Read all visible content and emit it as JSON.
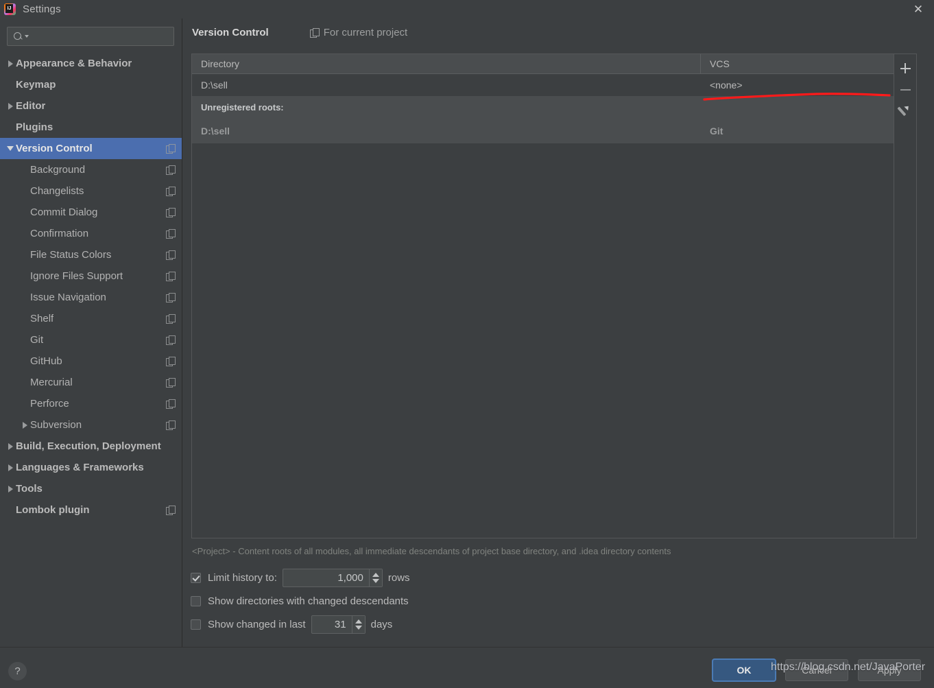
{
  "window": {
    "title": "Settings",
    "logo_icon": "intellij-idea-logo",
    "close_icon": "close-icon"
  },
  "sidebar": {
    "search": {
      "placeholder": "",
      "value": "",
      "icon": "search-icon",
      "dropdown_icon": "chevron-down-icon"
    },
    "items": [
      {
        "label": "Appearance & Behavior",
        "level": 0,
        "expandable": true,
        "expanded": false,
        "bold": true,
        "selected": false,
        "copy_icon": false
      },
      {
        "label": "Keymap",
        "level": 0,
        "expandable": false,
        "expanded": false,
        "bold": true,
        "selected": false,
        "copy_icon": false
      },
      {
        "label": "Editor",
        "level": 0,
        "expandable": true,
        "expanded": false,
        "bold": true,
        "selected": false,
        "copy_icon": false
      },
      {
        "label": "Plugins",
        "level": 0,
        "expandable": false,
        "expanded": false,
        "bold": true,
        "selected": false,
        "copy_icon": false
      },
      {
        "label": "Version Control",
        "level": 0,
        "expandable": true,
        "expanded": true,
        "bold": true,
        "selected": true,
        "copy_icon": true
      },
      {
        "label": "Background",
        "level": 1,
        "expandable": false,
        "expanded": false,
        "bold": false,
        "selected": false,
        "copy_icon": true
      },
      {
        "label": "Changelists",
        "level": 1,
        "expandable": false,
        "expanded": false,
        "bold": false,
        "selected": false,
        "copy_icon": true
      },
      {
        "label": "Commit Dialog",
        "level": 1,
        "expandable": false,
        "expanded": false,
        "bold": false,
        "selected": false,
        "copy_icon": true
      },
      {
        "label": "Confirmation",
        "level": 1,
        "expandable": false,
        "expanded": false,
        "bold": false,
        "selected": false,
        "copy_icon": true
      },
      {
        "label": "File Status Colors",
        "level": 1,
        "expandable": false,
        "expanded": false,
        "bold": false,
        "selected": false,
        "copy_icon": true
      },
      {
        "label": "Ignore Files Support",
        "level": 1,
        "expandable": false,
        "expanded": false,
        "bold": false,
        "selected": false,
        "copy_icon": true
      },
      {
        "label": "Issue Navigation",
        "level": 1,
        "expandable": false,
        "expanded": false,
        "bold": false,
        "selected": false,
        "copy_icon": true
      },
      {
        "label": "Shelf",
        "level": 1,
        "expandable": false,
        "expanded": false,
        "bold": false,
        "selected": false,
        "copy_icon": true
      },
      {
        "label": "Git",
        "level": 1,
        "expandable": false,
        "expanded": false,
        "bold": false,
        "selected": false,
        "copy_icon": true
      },
      {
        "label": "GitHub",
        "level": 1,
        "expandable": false,
        "expanded": false,
        "bold": false,
        "selected": false,
        "copy_icon": true
      },
      {
        "label": "Mercurial",
        "level": 1,
        "expandable": false,
        "expanded": false,
        "bold": false,
        "selected": false,
        "copy_icon": true
      },
      {
        "label": "Perforce",
        "level": 1,
        "expandable": false,
        "expanded": false,
        "bold": false,
        "selected": false,
        "copy_icon": true
      },
      {
        "label": "Subversion",
        "level": 1,
        "expandable": true,
        "expanded": false,
        "bold": false,
        "selected": false,
        "copy_icon": true
      },
      {
        "label": "Build, Execution, Deployment",
        "level": 0,
        "expandable": true,
        "expanded": false,
        "bold": true,
        "selected": false,
        "copy_icon": false
      },
      {
        "label": "Languages & Frameworks",
        "level": 0,
        "expandable": true,
        "expanded": false,
        "bold": true,
        "selected": false,
        "copy_icon": false
      },
      {
        "label": "Tools",
        "level": 0,
        "expandable": true,
        "expanded": false,
        "bold": true,
        "selected": false,
        "copy_icon": false
      },
      {
        "label": "Lombok plugin",
        "level": 0,
        "expandable": false,
        "expanded": false,
        "bold": true,
        "selected": false,
        "copy_icon": true
      }
    ]
  },
  "main": {
    "title": "Version Control",
    "scope_label": "For current project",
    "scope_icon": "copy-settings-icon",
    "table": {
      "columns": [
        "Directory",
        "VCS"
      ],
      "rows": [
        {
          "directory": "D:\\sell",
          "vcs": "<none>"
        }
      ],
      "section_title": "Unregistered roots:",
      "section_rows": [
        {
          "directory": "D:\\sell",
          "vcs": "Git"
        }
      ]
    },
    "toolbar": {
      "add_icon": "plus-icon",
      "remove_icon": "minus-icon",
      "edit_icon": "pencil-icon"
    },
    "hint": "<Project> - Content roots of all modules, all immediate descendants of project base directory, and .idea directory contents",
    "options": {
      "limit_history_label": "Limit history to:",
      "limit_history_checked": true,
      "limit_history_value": "1,000",
      "limit_history_suffix": "rows",
      "show_dirs_label": "Show directories with changed descendants",
      "show_dirs_checked": false,
      "show_changed_label": "Show changed in last",
      "show_changed_checked": false,
      "show_changed_value": "31",
      "show_changed_suffix": "days"
    }
  },
  "footer": {
    "help_label": "?",
    "ok_label": "OK",
    "cancel_label": "Cancel",
    "apply_label": "Apply"
  },
  "annotation": {
    "watermark": "https://blog.csdn.net/JavaPorter",
    "underline_color": "#ff1a1a"
  },
  "colors": {
    "background": "#3c3f41",
    "selection": "#4b6eaf",
    "header_row": "#4a4d4f",
    "text": "#bbbbbb",
    "accent_button": "#365880"
  }
}
